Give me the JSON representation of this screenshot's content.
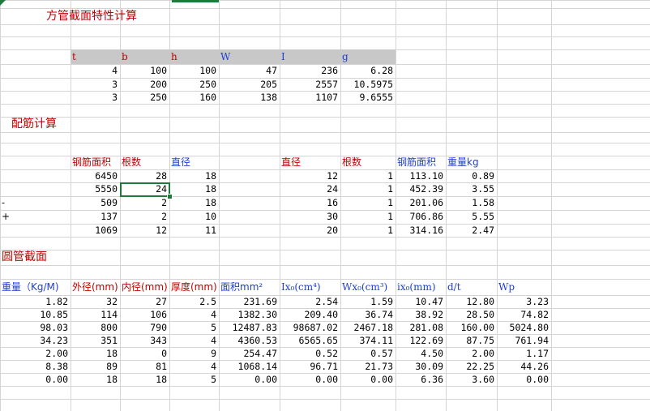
{
  "sheet": {
    "titles": {
      "square_tube": "方管截面特性计算",
      "rebar": "配筋计算",
      "round_tube": "圆管截面"
    },
    "square_table": {
      "headers": [
        "t",
        "b",
        "h",
        "W",
        "I",
        "g"
      ],
      "rows": [
        [
          "4",
          "100",
          "100",
          "47",
          "236",
          "6.28"
        ],
        [
          "3",
          "200",
          "250",
          "205",
          "2557",
          "10.5975"
        ],
        [
          "3",
          "250",
          "160",
          "138",
          "1107",
          "9.6555"
        ]
      ]
    },
    "rebar_left": {
      "headers": [
        "钢筋面积",
        "根数",
        "直径"
      ],
      "rows": [
        [
          "6450",
          "28",
          "18"
        ],
        [
          "5550",
          "24",
          "18"
        ],
        [
          "509",
          "2",
          "18"
        ],
        [
          "137",
          "2",
          "10"
        ],
        [
          "1069",
          "12",
          "11"
        ]
      ],
      "row_markers": [
        "",
        "",
        "-",
        "+",
        ""
      ]
    },
    "rebar_right": {
      "headers": [
        "直径",
        "根数",
        "钢筋面积",
        "重量kg"
      ],
      "rows": [
        [
          "12",
          "1",
          "113.10",
          "0.89"
        ],
        [
          "24",
          "1",
          "452.39",
          "3.55"
        ],
        [
          "16",
          "1",
          "201.06",
          "1.58"
        ],
        [
          "30",
          "1",
          "706.86",
          "5.55"
        ],
        [
          "20",
          "1",
          "314.16",
          "2.47"
        ]
      ]
    },
    "round_table": {
      "headers": [
        "重量（Kg/M)",
        "外径(mm)",
        "内径(mm)",
        "厚度(mm)",
        "面积mm²",
        "Ix₀(cm⁴)",
        "Wx₀(cm³)",
        "ix₀(mm)",
        "d/t",
        "Wp"
      ],
      "rows": [
        [
          "1.82",
          "32",
          "27",
          "2.5",
          "231.69",
          "2.54",
          "1.59",
          "10.47",
          "12.80",
          "3.23"
        ],
        [
          "10.85",
          "114",
          "106",
          "4",
          "1382.30",
          "209.40",
          "36.74",
          "38.92",
          "28.50",
          "74.82"
        ],
        [
          "98.03",
          "800",
          "790",
          "5",
          "12487.83",
          "98687.02",
          "2467.18",
          "281.08",
          "160.00",
          "5024.80"
        ],
        [
          "34.23",
          "351",
          "343",
          "4",
          "4360.53",
          "6565.65",
          "374.11",
          "122.69",
          "87.75",
          "761.94"
        ],
        [
          "2.00",
          "18",
          "0",
          "9",
          "254.47",
          "0.52",
          "0.57",
          "4.50",
          "2.00",
          "1.17"
        ],
        [
          "8.38",
          "89",
          "81",
          "4",
          "1068.14",
          "96.71",
          "21.73",
          "30.09",
          "22.25",
          "44.26"
        ],
        [
          "0.00",
          "18",
          "18",
          "5",
          "0.00",
          "0.00",
          "0.00",
          "6.36",
          "3.60",
          "0.00"
        ]
      ]
    },
    "selection": {
      "ref": "C13"
    }
  }
}
